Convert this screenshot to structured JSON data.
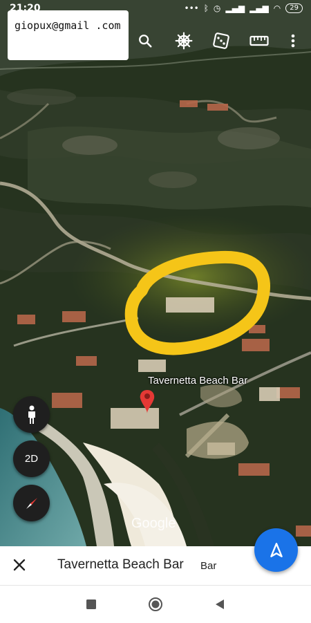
{
  "status_bar": {
    "time": "21:20",
    "battery": "29"
  },
  "note": {
    "text": "giopux@gmail .com"
  },
  "toolbar": {
    "buttons": [
      {
        "name": "search",
        "icon": "search-icon"
      },
      {
        "name": "voyager",
        "icon": "ship-wheel-icon"
      },
      {
        "name": "feeling-lucky",
        "icon": "dice-icon"
      },
      {
        "name": "measure",
        "icon": "ruler-icon"
      },
      {
        "name": "more",
        "icon": "more-vert-icon"
      }
    ]
  },
  "map": {
    "place_label": "Tavernetta Beach Bar",
    "watermark": "Google",
    "highlight_color": "#f5c518",
    "marker_color": "#e53935"
  },
  "controls": {
    "street_view_icon": "pegman-icon",
    "view_mode": "2D",
    "compass_icon": "compass-icon"
  },
  "bottom_card": {
    "title": "Tavernetta Beach Bar",
    "category": "Bar"
  },
  "nav_fab": {
    "icon": "navigation-arrow-icon",
    "color": "#1a73e8"
  }
}
